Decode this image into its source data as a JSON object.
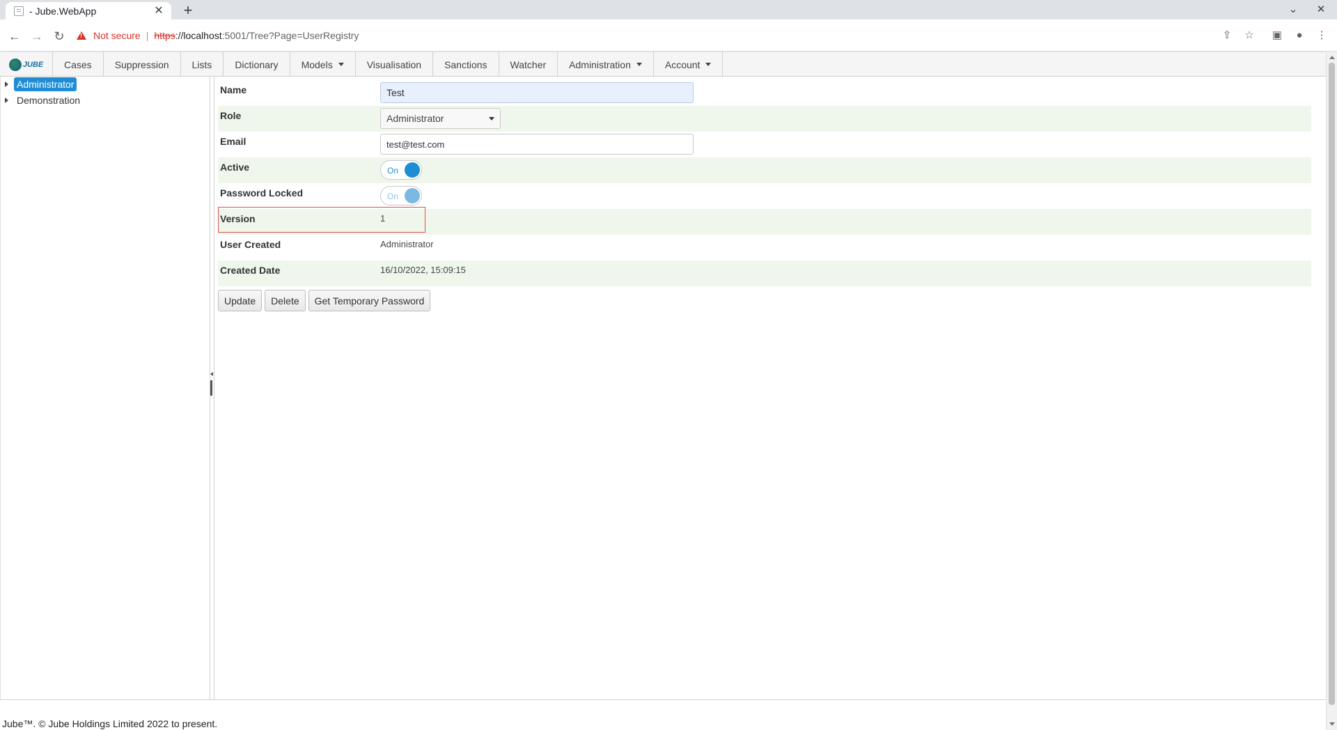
{
  "browser": {
    "tab_title": "- Jube.WebApp",
    "tab_close": "✕",
    "new_tab": "+",
    "security_label": "Not secure",
    "url_scheme": "https",
    "url_host": "://localhost",
    "url_rest": ":5001/Tree?Page=UserRegistry"
  },
  "app": {
    "logo_text": "JUBE",
    "menu": [
      {
        "label": "Cases"
      },
      {
        "label": "Suppression"
      },
      {
        "label": "Lists"
      },
      {
        "label": "Dictionary"
      },
      {
        "label": "Models"
      },
      {
        "label": "Visualisation"
      },
      {
        "label": "Sanctions"
      },
      {
        "label": "Watcher"
      },
      {
        "label": "Administration"
      },
      {
        "label": "Account"
      }
    ]
  },
  "tree": {
    "nodes": [
      {
        "label": "Administrator",
        "selected": true
      },
      {
        "label": "Demonstration",
        "selected": false
      }
    ]
  },
  "form": {
    "name_label": "Name",
    "name_value": "Test",
    "role_label": "Role",
    "role_value": "Administrator",
    "email_label": "Email",
    "email_value": "test@test.com",
    "active_label": "Active",
    "active_toggle": "On",
    "password_locked_label": "Password Locked",
    "password_locked_toggle": "On",
    "version_label": "Version",
    "version_value": "1",
    "user_created_label": "User Created",
    "user_created_value": "Administrator",
    "created_date_label": "Created Date",
    "created_date_value": "16/10/2022, 15:09:15"
  },
  "actions": {
    "update": "Update",
    "delete": "Delete",
    "temp_password": "Get Temporary Password"
  },
  "footer": {
    "text": "Jube™. © Jube Holdings Limited 2022 to present."
  },
  "colors": {
    "accent": "#1f8dd6",
    "row_alt": "#eff7ec",
    "highlight_border": "#e05050"
  }
}
